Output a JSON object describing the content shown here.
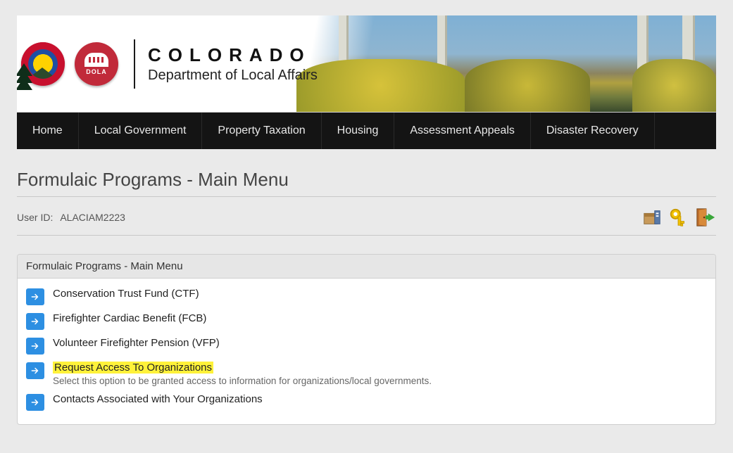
{
  "brand": {
    "line1": "COLORADO",
    "line2": "Department of Local Affairs",
    "dola_label": "DOLA"
  },
  "nav": {
    "items": [
      "Home",
      "Local Government",
      "Property Taxation",
      "Housing",
      "Assessment Appeals",
      "Disaster Recovery"
    ]
  },
  "page": {
    "title": "Formulaic Programs - Main Menu"
  },
  "user": {
    "label": "User ID:",
    "id": "ALACIAM2223"
  },
  "panel": {
    "title": "Formulaic Programs - Main Menu",
    "items": [
      {
        "title": "Conservation Trust Fund (CTF)",
        "sub": "",
        "highlight": false
      },
      {
        "title": "Firefighter Cardiac Benefit (FCB)",
        "sub": "",
        "highlight": false
      },
      {
        "title": "Volunteer Firefighter Pension (VFP)",
        "sub": "",
        "highlight": false
      },
      {
        "title": "Request Access To Organizations",
        "sub": "Select this option to be granted access to information for organizations/local governments.",
        "highlight": true
      },
      {
        "title": "Contacts Associated with Your Organizations",
        "sub": "",
        "highlight": false
      }
    ]
  }
}
